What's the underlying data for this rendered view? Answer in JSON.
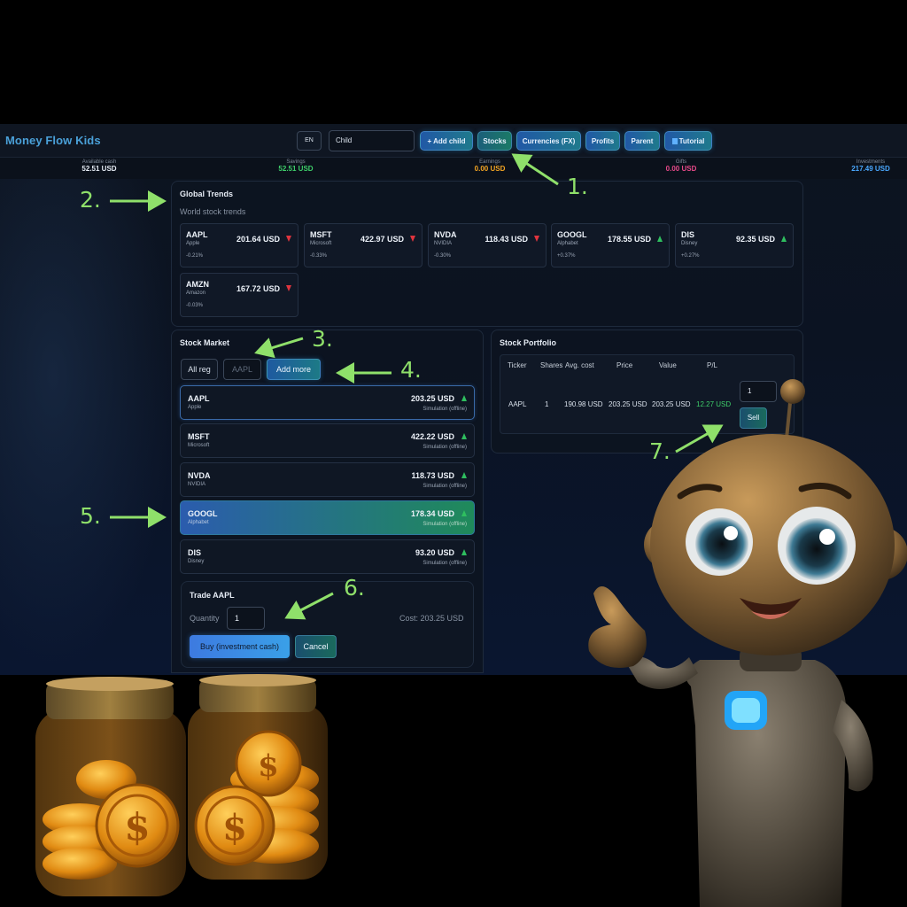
{
  "app": {
    "title": "Money Flow Kids"
  },
  "header": {
    "lang": "EN",
    "child_select": "Child",
    "buttons": [
      "+ Add child",
      "Stocks",
      "Currencies (FX)",
      "Profits",
      "Parent",
      "Tutorial"
    ]
  },
  "stats": [
    {
      "label": "Available cash",
      "value": "52.51 USD",
      "color": "#e6ecf5"
    },
    {
      "label": "Savings",
      "value": "52.51 USD",
      "color": "#3ecf6a"
    },
    {
      "label": "Earnings",
      "value": "0.00 USD",
      "color": "#f5a623"
    },
    {
      "label": "Gifts",
      "value": "0.00 USD",
      "color": "#e84a8a"
    },
    {
      "label": "Investments",
      "value": "217.49 USD",
      "color": "#4aa8ff"
    }
  ],
  "global_trends": {
    "title": "Global Trends",
    "subtitle": "World stock trends",
    "items": [
      {
        "ticker": "AAPL",
        "name": "Apple",
        "price": "201.64 USD",
        "change": "-0.21%",
        "direction": "down"
      },
      {
        "ticker": "MSFT",
        "name": "Microsoft",
        "price": "422.97 USD",
        "change": "-0.33%",
        "direction": "down"
      },
      {
        "ticker": "NVDA",
        "name": "NVIDIA",
        "price": "118.43 USD",
        "change": "-0.30%",
        "direction": "down"
      },
      {
        "ticker": "GOOGL",
        "name": "Alphabet",
        "price": "178.55 USD",
        "change": "+0.37%",
        "direction": "up"
      },
      {
        "ticker": "DIS",
        "name": "Disney",
        "price": "92.35 USD",
        "change": "+0.27%",
        "direction": "up"
      },
      {
        "ticker": "AMZN",
        "name": "Amazon",
        "price": "167.72 USD",
        "change": "-0.03%",
        "direction": "down"
      }
    ]
  },
  "stock_market": {
    "title": "Stock Market",
    "region_button": "All reg",
    "search_placeholder": "AAPL",
    "add_more": "Add more",
    "rows": [
      {
        "ticker": "AAPL",
        "name": "Apple",
        "price": "203.25 USD",
        "status": "Simulation (offline)"
      },
      {
        "ticker": "MSFT",
        "name": "Microsoft",
        "price": "422.22 USD",
        "status": "Simulation (offline)"
      },
      {
        "ticker": "NVDA",
        "name": "NVIDIA",
        "price": "118.73 USD",
        "status": "Simulation (offline)"
      },
      {
        "ticker": "GOOGL",
        "name": "Alphabet",
        "price": "178.34 USD",
        "status": "Simulation (offline)"
      },
      {
        "ticker": "DIS",
        "name": "Disney",
        "price": "93.20 USD",
        "status": "Simulation (offline)"
      }
    ]
  },
  "trade": {
    "title": "Trade AAPL",
    "quantity_label": "Quantity",
    "quantity_value": "1",
    "cost": "Cost: 203.25 USD",
    "buy_button": "Buy (investment cash)",
    "cancel_button": "Cancel"
  },
  "portfolio": {
    "title": "Stock Portfolio",
    "columns": [
      "Ticker",
      "Shares",
      "Avg. cost",
      "Price",
      "Value",
      "P/L"
    ],
    "row": {
      "ticker": "AAPL",
      "shares": "1",
      "avg_cost": "190.98 USD",
      "price": "203.25 USD",
      "value": "203.25 USD",
      "pl": "12.27 USD"
    },
    "sell_quantity": "1",
    "sell_button": "Sell"
  },
  "annotations": [
    "1.",
    "2.",
    "3.",
    "4.",
    "5.",
    "6.",
    "7."
  ],
  "colors": {
    "annotation": "#8fe06a",
    "up": "#2fbf5f",
    "down": "#e0343e"
  }
}
